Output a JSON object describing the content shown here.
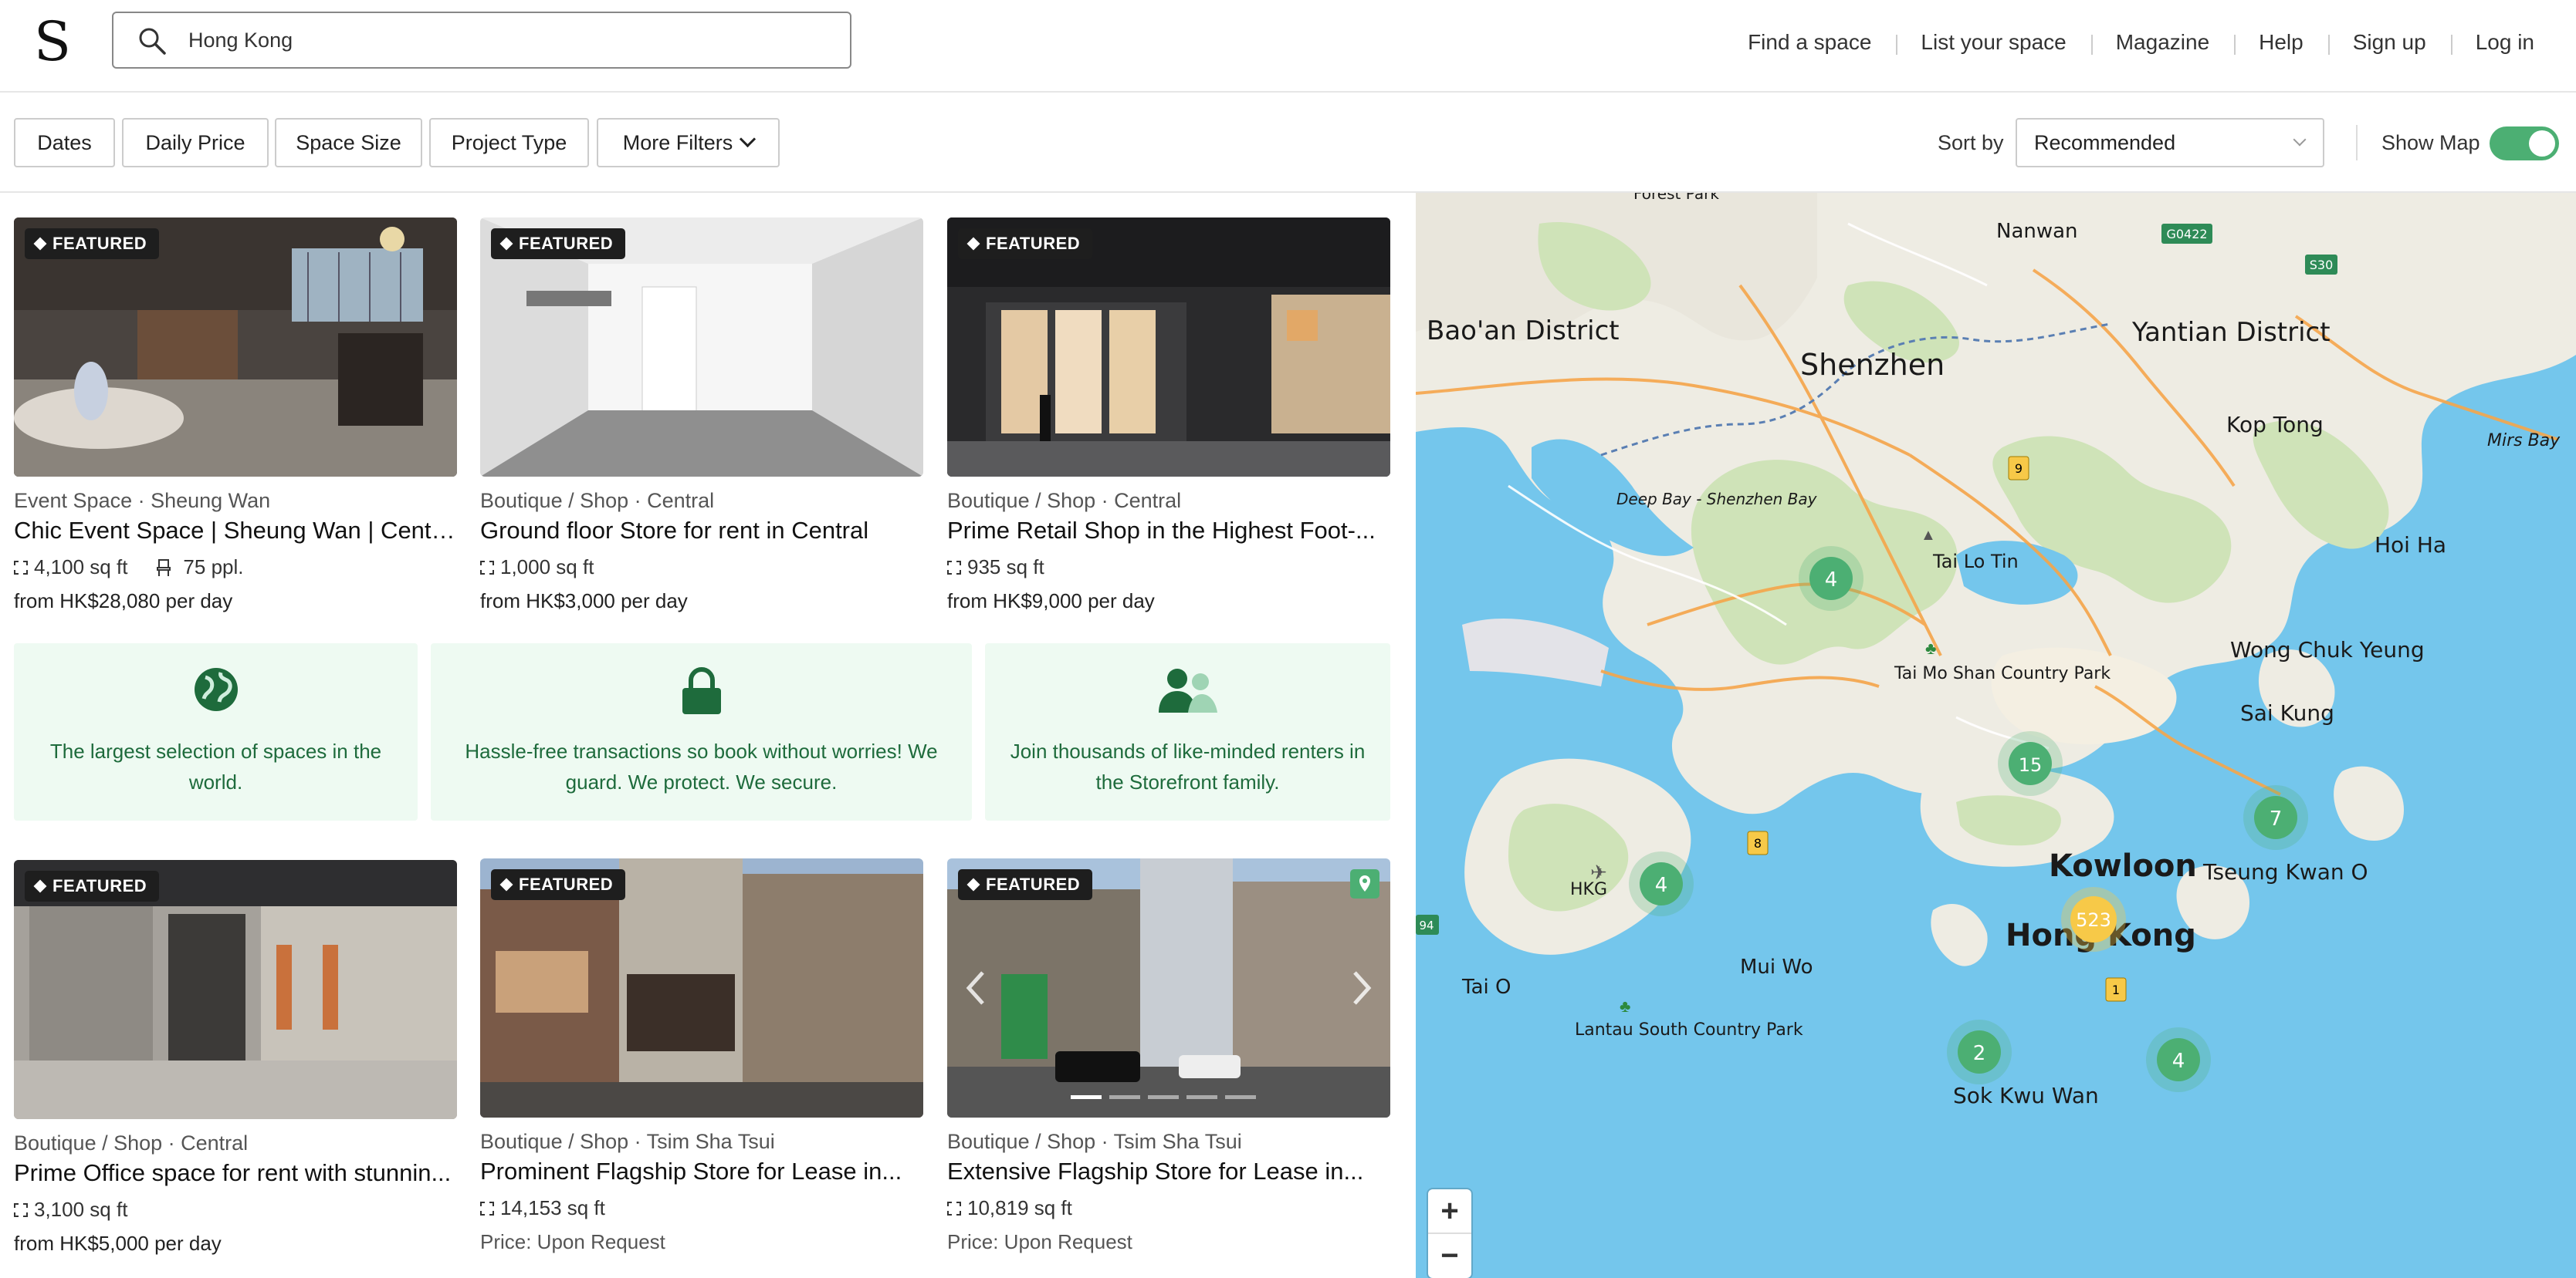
{
  "header": {
    "logo": "S",
    "search_value": "Hong Kong",
    "nav": [
      "Find a space",
      "List your space",
      "Magazine",
      "Help",
      "Sign up",
      "Log in"
    ]
  },
  "filters": {
    "buttons": [
      "Dates",
      "Daily Price",
      "Space Size",
      "Project Type",
      "More Filters"
    ],
    "sort_label": "Sort by",
    "sort_value": "Recommended",
    "show_map_label": "Show Map",
    "show_map_on": true
  },
  "featured_label": "FEATURED",
  "listings": [
    {
      "category": "Event Space · Sheung Wan",
      "title": "Chic Event Space | Sheung Wan | Central",
      "size": "4,100 sq ft",
      "people": "75 ppl.",
      "price": "from HK$28,080 per day"
    },
    {
      "category": "Boutique / Shop · Central",
      "title": "Ground floor Store for rent in Central",
      "size": "1,000 sq ft",
      "price": "from HK$3,000 per day"
    },
    {
      "category": "Boutique / Shop · Central",
      "title": "Prime Retail Shop in the Highest Foot-...",
      "size": "935 sq ft",
      "price": "from HK$9,000 per day"
    },
    {
      "category": "Boutique / Shop · Central",
      "title": "Prime Office space for rent with stunnin...",
      "size": "3,100 sq ft",
      "price": "from HK$5,000 per day"
    },
    {
      "category": "Boutique / Shop · Tsim Sha Tsui",
      "title": "Prominent Flagship Store for Lease in...",
      "size": "14,153 sq ft",
      "price": "Price: Upon Request"
    },
    {
      "category": "Boutique / Shop · Tsim Sha Tsui",
      "title": "Extensive Flagship Store for Lease in...",
      "size": "10,819 sq ft",
      "price": "Price: Upon Request"
    }
  ],
  "value_props": [
    {
      "icon": "globe-icon",
      "text": "The largest selection of spaces in the world."
    },
    {
      "icon": "lock-icon",
      "text": "Hassle-free transactions so book without worries! We guard. We protect. We secure."
    },
    {
      "icon": "people-icon",
      "text": "Join thousands of like-minded renters in the Storefront family."
    }
  ],
  "map": {
    "labels": [
      "Forest Park",
      "Nanwan",
      "G0422",
      "S30",
      "Bao'an District",
      "Shenzhen",
      "Yantian District",
      "Kop Tong",
      "Mirs Bay",
      "Deep Bay - Shenzhen Bay",
      "Hoi Ha",
      "Tai Lo Tin",
      "Tai Mo Shan Country Park",
      "Wong Chuk Yeung",
      "Sai Kung",
      "Kowloon",
      "Tseung Kwan O",
      "HKG",
      "Hong Kong",
      "Tai O",
      "Mui Wo",
      "Lantau South Country Park",
      "Sok Kwu Wan",
      "9",
      "8",
      "1",
      "94"
    ],
    "clusters": [
      "4",
      "15",
      "7",
      "4",
      "523",
      "2",
      "4"
    ],
    "zoom_in": "+",
    "zoom_out": "−"
  },
  "colors": {
    "accent": "#4caf73",
    "brand_green": "#1e6b3c",
    "panel_bg": "#eefaf2",
    "water": "#74c6ec",
    "land": "#f2efe6"
  }
}
